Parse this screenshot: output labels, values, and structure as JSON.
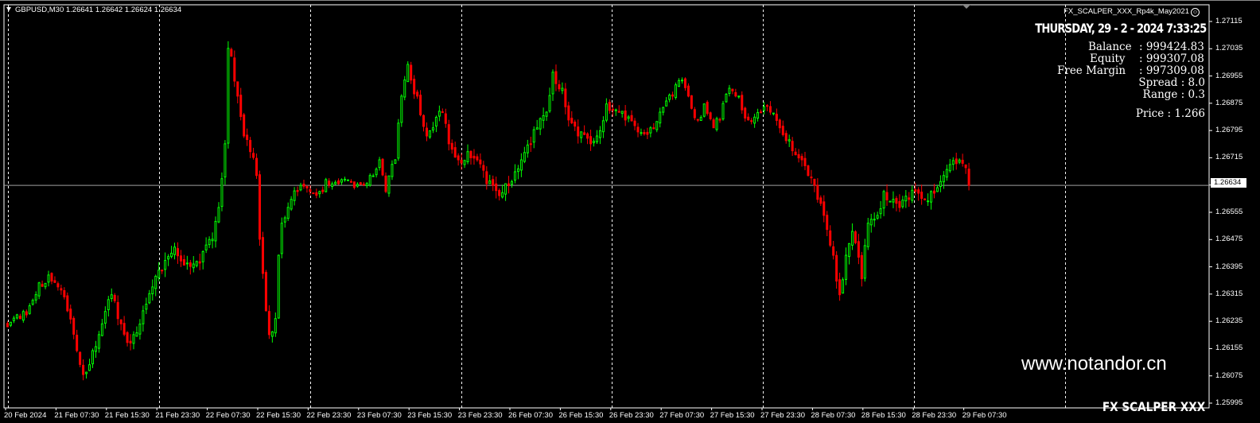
{
  "header": {
    "symbol_info": "GBPUSD,M30  1.26641 1.26642 1.26624 1.26634"
  },
  "ea": {
    "name": "FX_SCALPER_XXX_Rp4k_May2021",
    "clock": "THURSDAY, 29 - 2 - 2024 7:33:25",
    "balance_label": "Balance",
    "balance_value": ": 999424.83",
    "equity_label": "Equity",
    "equity_value": ": 999307.08",
    "free_margin_label": "Free Margin",
    "free_margin_value": ": 997309.08",
    "spread": "Spread  : 8.0",
    "range": "Range : 0.3",
    "price": "Price : 1.266"
  },
  "watermark": "www.notandor.cn",
  "brand": "FX SCALPER XXX",
  "colors": {
    "bull": "#00ff00",
    "bear": "#ff0000",
    "grid": "#ffffff",
    "price_line": "#a0a0a0"
  },
  "chart_data": {
    "type": "candlestick",
    "symbol": "GBPUSD",
    "timeframe": "M30",
    "current_price": "1.26634",
    "ylim": [
      1.25995,
      1.27115
    ],
    "y_ticks": [
      "1.27115",
      "1.27035",
      "1.26955",
      "1.26875",
      "1.26795",
      "1.26715",
      "1.26635",
      "1.26555",
      "1.26475",
      "1.26395",
      "1.26315",
      "1.26235",
      "1.26155",
      "1.26075",
      "1.25995"
    ],
    "x_ticks": [
      "20 Feb 2024",
      "21 Feb 07:30",
      "21 Feb 15:30",
      "21 Feb 23:30",
      "22 Feb 07:30",
      "22 Feb 15:30",
      "22 Feb 23:30",
      "23 Feb 07:30",
      "23 Feb 15:30",
      "23 Feb 23:30",
      "26 Feb 07:30",
      "26 Feb 15:30",
      "26 Feb 23:30",
      "27 Feb 07:30",
      "27 Feb 15:30",
      "27 Feb 23:30",
      "28 Feb 07:30",
      "28 Feb 15:30",
      "28 Feb 23:30",
      "29 Feb 07:30"
    ],
    "bars_per_tick": 16,
    "close_anchors_bar_price": [
      [
        0,
        1.26219
      ],
      [
        4,
        1.26243
      ],
      [
        6,
        1.26254
      ],
      [
        10,
        1.26348
      ],
      [
        13,
        1.26371
      ],
      [
        16,
        1.26336
      ],
      [
        19,
        1.26266
      ],
      [
        22,
        1.26149
      ],
      [
        24,
        1.26079
      ],
      [
        27,
        1.26149
      ],
      [
        29,
        1.26196
      ],
      [
        33,
        1.26313
      ],
      [
        35,
        1.26243
      ],
      [
        38,
        1.26173
      ],
      [
        40,
        1.26196
      ],
      [
        43,
        1.26266
      ],
      [
        46,
        1.26336
      ],
      [
        49,
        1.26383
      ],
      [
        53,
        1.26453
      ],
      [
        57,
        1.26406
      ],
      [
        61,
        1.26406
      ],
      [
        65,
        1.26476
      ],
      [
        67,
        1.26569
      ],
      [
        69,
        1.26756
      ],
      [
        70,
        1.27036
      ],
      [
        71,
        1.27013
      ],
      [
        73,
        1.26896
      ],
      [
        75,
        1.26779
      ],
      [
        77,
        1.26733
      ],
      [
        79,
        1.26663
      ],
      [
        80,
        1.26476
      ],
      [
        82,
        1.26266
      ],
      [
        83,
        1.26196
      ],
      [
        85,
        1.26243
      ],
      [
        86,
        1.26429
      ],
      [
        87,
        1.26523
      ],
      [
        90,
        1.26593
      ],
      [
        92,
        1.26616
      ],
      [
        96,
        1.26616
      ],
      [
        99,
        1.26616
      ],
      [
        101,
        1.26651
      ],
      [
        105,
        1.26639
      ],
      [
        110,
        1.26628
      ],
      [
        115,
        1.26663
      ],
      [
        118,
        1.26709
      ],
      [
        120,
        1.26616
      ],
      [
        123,
        1.26709
      ],
      [
        125,
        1.26896
      ],
      [
        127,
        1.26989
      ],
      [
        128,
        1.26943
      ],
      [
        130,
        1.26896
      ],
      [
        133,
        1.26779
      ],
      [
        135,
        1.26803
      ],
      [
        138,
        1.26849
      ],
      [
        140,
        1.26756
      ],
      [
        143,
        1.26709
      ],
      [
        146,
        1.26733
      ],
      [
        149,
        1.26709
      ],
      [
        152,
        1.26639
      ],
      [
        156,
        1.26604
      ],
      [
        158,
        1.26639
      ],
      [
        161,
        1.26674
      ],
      [
        163,
        1.26709
      ],
      [
        166,
        1.26756
      ],
      [
        168,
        1.26803
      ],
      [
        171,
        1.26849
      ],
      [
        173,
        1.26966
      ],
      [
        176,
        1.26919
      ],
      [
        178,
        1.26826
      ],
      [
        181,
        1.26779
      ],
      [
        185,
        1.26756
      ],
      [
        187,
        1.26779
      ],
      [
        190,
        1.26873
      ],
      [
        194,
        1.26849
      ],
      [
        196,
        1.26826
      ],
      [
        200,
        1.26791
      ],
      [
        204,
        1.26803
      ],
      [
        207,
        1.26849
      ],
      [
        211,
        1.26896
      ],
      [
        214,
        1.26943
      ],
      [
        216,
        1.26896
      ],
      [
        219,
        1.26826
      ],
      [
        221,
        1.26873
      ],
      [
        224,
        1.26803
      ],
      [
        226,
        1.26826
      ],
      [
        229,
        1.26919
      ],
      [
        232,
        1.26896
      ],
      [
        235,
        1.26826
      ],
      [
        239,
        1.26849
      ],
      [
        242,
        1.26849
      ],
      [
        245,
        1.26803
      ],
      [
        248,
        1.26768
      ],
      [
        252,
        1.26709
      ],
      [
        254,
        1.26663
      ],
      [
        257,
        1.26593
      ],
      [
        259,
        1.26546
      ],
      [
        262,
        1.26429
      ],
      [
        264,
        1.26313
      ],
      [
        266,
        1.26429
      ],
      [
        268,
        1.26499
      ],
      [
        271,
        1.2636
      ],
      [
        273,
        1.26523
      ],
      [
        276,
        1.26546
      ],
      [
        278,
        1.26616
      ],
      [
        281,
        1.26593
      ],
      [
        283,
        1.26569
      ],
      [
        286,
        1.26593
      ],
      [
        288,
        1.26616
      ],
      [
        291,
        1.26593
      ],
      [
        293,
        1.26616
      ],
      [
        297,
        1.26663
      ],
      [
        301,
        1.26698
      ],
      [
        304,
        1.26686
      ],
      [
        305,
        1.26634
      ]
    ]
  }
}
